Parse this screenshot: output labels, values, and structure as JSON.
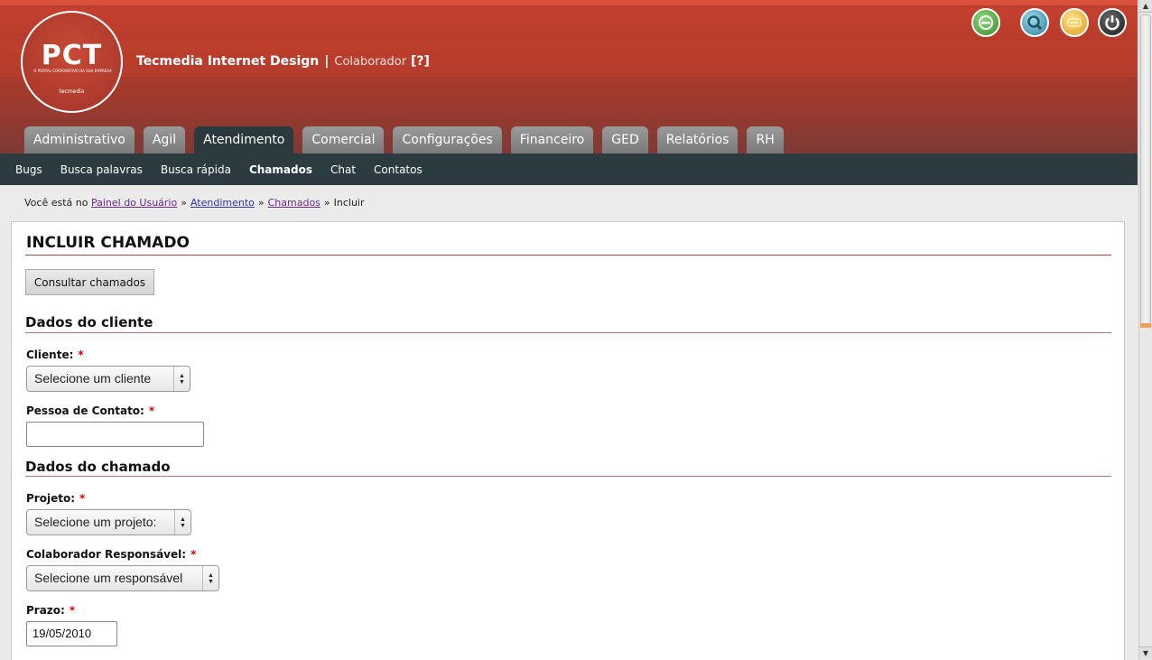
{
  "header": {
    "logo_text": "PCT",
    "logo_subtitle": "O PORTAL CORPORATIVO DA SUA EMPRESA",
    "logo_brand": "tecmedia",
    "company_name": "Tecmedia Internet Design",
    "separator": "|",
    "role": "Colaborador",
    "help": "[?]",
    "icons": [
      "green-status-icon",
      "search-user-icon",
      "rating-icon",
      "power-icon"
    ]
  },
  "tabs": [
    {
      "label": "Administrativo"
    },
    {
      "label": "Agil"
    },
    {
      "label": "Atendimento"
    },
    {
      "label": "Comercial"
    },
    {
      "label": "Configurações"
    },
    {
      "label": "Financeiro"
    },
    {
      "label": "GED"
    },
    {
      "label": "Relatórios"
    },
    {
      "label": "RH"
    }
  ],
  "active_tab": "Atendimento",
  "subnav": [
    {
      "label": "Bugs"
    },
    {
      "label": "Busca palavras"
    },
    {
      "label": "Busca rápida"
    },
    {
      "label": "Chamados"
    },
    {
      "label": "Chat"
    },
    {
      "label": "Contatos"
    }
  ],
  "breadcrumb": {
    "prefix": "Você está no",
    "items": [
      "Painel do Usuário",
      "Atendimento",
      "Chamados"
    ],
    "current": "Incluir",
    "sep": "»"
  },
  "page": {
    "title": "INCLUIR CHAMADO",
    "consult_button": "Consultar chamados",
    "section_client": "Dados do cliente",
    "section_call": "Dados do chamado",
    "required_mark": "*",
    "fields": {
      "cliente_label": "Cliente:",
      "cliente_value": "Selecione um cliente",
      "contato_label": "Pessoa de Contato:",
      "contato_value": "",
      "projeto_label": "Projeto:",
      "projeto_value": "Selecione um projeto:",
      "responsavel_label": "Colaborador Responsável:",
      "responsavel_value": "Selecione um responsável",
      "prazo_label": "Prazo:",
      "prazo_value": "19/05/2010"
    }
  },
  "colors": {
    "header_red": "#b33a2a",
    "subnav_dark": "#2b3b3f",
    "rule_red": "#b5474a"
  }
}
